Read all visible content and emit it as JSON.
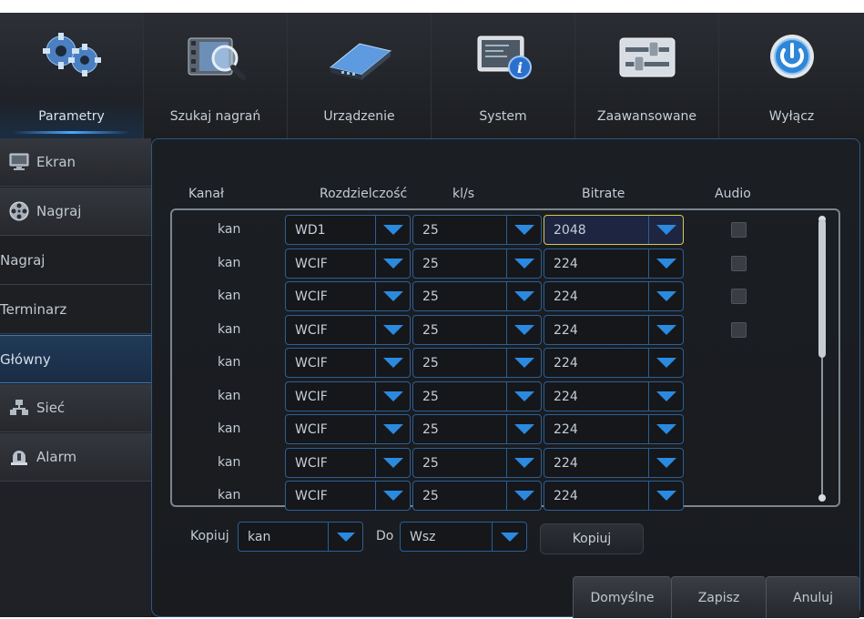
{
  "top_menu": {
    "tabs": [
      {
        "label": "Parametry",
        "icon": "gears-icon",
        "active": true
      },
      {
        "label": "Szukaj nagrań",
        "icon": "film-search-icon",
        "active": false
      },
      {
        "label": "Urządzenie",
        "icon": "hard-drive-icon",
        "active": false
      },
      {
        "label": "System",
        "icon": "system-info-icon",
        "active": false
      },
      {
        "label": "Zaawansowane",
        "icon": "sliders-icon",
        "active": false
      },
      {
        "label": "Wyłącz",
        "icon": "power-icon",
        "active": false
      }
    ]
  },
  "sidebar": {
    "items": [
      {
        "label": "Ekran",
        "icon": "monitor-icon",
        "type": "section"
      },
      {
        "label": "Nagraj",
        "icon": "film-reel-icon",
        "type": "section"
      },
      {
        "label": "Nagraj",
        "type": "sub"
      },
      {
        "label": "Terminarz",
        "type": "sub"
      },
      {
        "label": "Główny",
        "type": "sub",
        "selected": true
      },
      {
        "label": "Sieć",
        "icon": "network-icon",
        "type": "section"
      },
      {
        "label": "Alarm",
        "icon": "alarm-bell-icon",
        "type": "section"
      }
    ]
  },
  "table": {
    "headers": {
      "channel": "Kanał",
      "resolution": "Rozdzielczość",
      "fps": "kl/s",
      "bitrate": "Bitrate",
      "audio": "Audio"
    },
    "rows": [
      {
        "channel": "kan",
        "resolution": "WD1",
        "fps": "25",
        "bitrate": "2048",
        "audio": false,
        "has_audio": true,
        "focused": true
      },
      {
        "channel": "kan",
        "resolution": "WCIF",
        "fps": "25",
        "bitrate": "224",
        "audio": false,
        "has_audio": true
      },
      {
        "channel": "kan",
        "resolution": "WCIF",
        "fps": "25",
        "bitrate": "224",
        "audio": false,
        "has_audio": true
      },
      {
        "channel": "kan",
        "resolution": "WCIF",
        "fps": "25",
        "bitrate": "224",
        "audio": false,
        "has_audio": true
      },
      {
        "channel": "kan",
        "resolution": "WCIF",
        "fps": "25",
        "bitrate": "224",
        "has_audio": false
      },
      {
        "channel": "kan",
        "resolution": "WCIF",
        "fps": "25",
        "bitrate": "224",
        "has_audio": false
      },
      {
        "channel": "kan",
        "resolution": "WCIF",
        "fps": "25",
        "bitrate": "224",
        "has_audio": false
      },
      {
        "channel": "kan",
        "resolution": "WCIF",
        "fps": "25",
        "bitrate": "224",
        "has_audio": false
      },
      {
        "channel": "kan",
        "resolution": "WCIF",
        "fps": "25",
        "bitrate": "224",
        "has_audio": false
      }
    ]
  },
  "copy": {
    "label": "Kopiuj",
    "source_value": "kan",
    "to_label": "Do",
    "target_value": "Wsz",
    "button": "Kopiuj"
  },
  "buttons": {
    "defaults": "Domyślne",
    "save": "Zapisz",
    "cancel": "Anuluj"
  },
  "colors": {
    "accent": "#2a78c8",
    "focus": "#d9c84a",
    "background": "#1b1d21"
  }
}
